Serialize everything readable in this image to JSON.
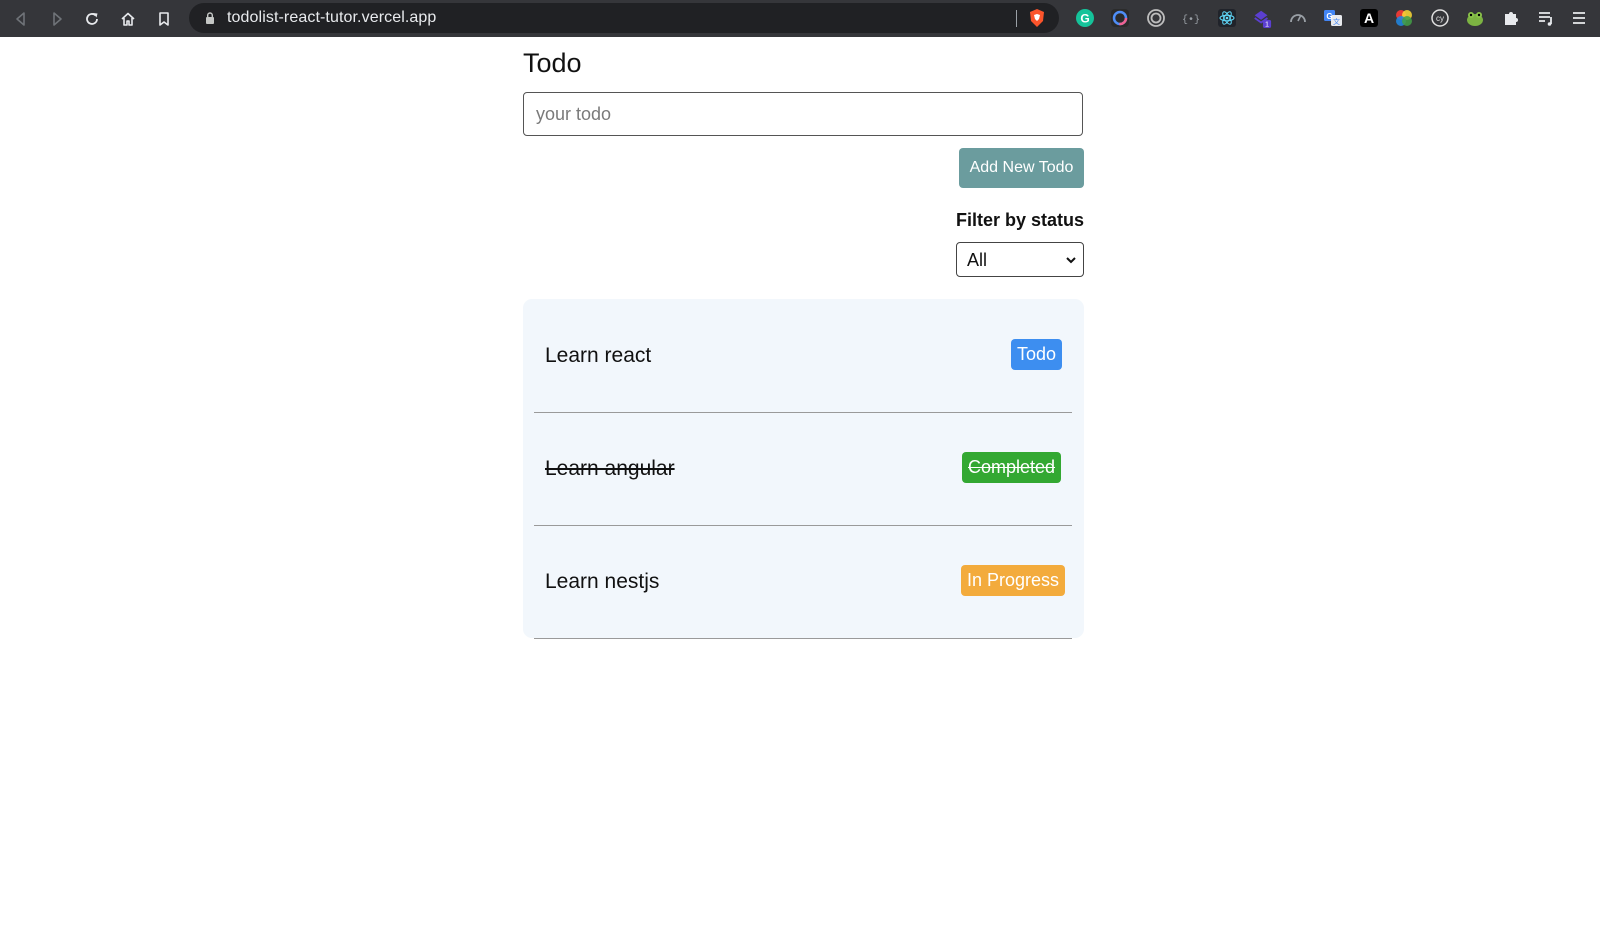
{
  "browser": {
    "url": "todolist-react-tutor.vercel.app",
    "nav_icons": [
      "back-icon",
      "forward-icon",
      "reload-icon",
      "home-icon",
      "bookmark-icon"
    ],
    "extensions": [
      {
        "name": "grammarly-icon",
        "color": "#15c39a"
      },
      {
        "name": "ring-extension-icon",
        "color": "#4f8ef7"
      },
      {
        "name": "target-extension-icon",
        "color": "#bdbdbd"
      },
      {
        "name": "json-viewer-icon",
        "color": "#9aa0a6"
      },
      {
        "name": "react-devtools-icon",
        "color": "#61dafb"
      },
      {
        "name": "stack-extension-icon",
        "color": "#5b3fd1",
        "badge": "1"
      },
      {
        "name": "gauge-extension-icon",
        "color": "#9aa0a6"
      },
      {
        "name": "translate-icon",
        "color": "#4285f4"
      },
      {
        "name": "font-extension-icon",
        "color": "#ffffff"
      },
      {
        "name": "color-picker-icon",
        "color": "#e53935"
      },
      {
        "name": "cypress-icon",
        "color": "#e0e0e0"
      },
      {
        "name": "frog-extension-icon",
        "color": "#7cb342"
      },
      {
        "name": "puzzle-icon",
        "color": "#e8eaed"
      },
      {
        "name": "media-controls-icon",
        "color": "#e8eaed"
      },
      {
        "name": "menu-icon",
        "color": "#e8eaed"
      }
    ]
  },
  "page": {
    "title": "Todo",
    "input_placeholder": "your todo",
    "add_button_label": "Add New Todo",
    "filter_label": "Filter by status",
    "filter_selected": "All"
  },
  "todos": [
    {
      "label": "Learn react",
      "status": "Todo",
      "status_color": "#3d8ef0",
      "done": false
    },
    {
      "label": "Learn angular",
      "status": "Completed",
      "status_color": "#33a832",
      "done": true
    },
    {
      "label": "Learn nestjs",
      "status": "In Progress",
      "status_color": "#f3ab3c",
      "done": false
    }
  ],
  "colors": {
    "add_button": "#6b9c9e",
    "list_background": "#f2f7fc",
    "chrome_background": "#35363a"
  }
}
